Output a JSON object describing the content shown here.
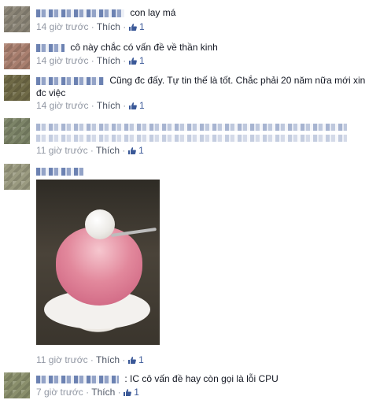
{
  "comments": [
    {
      "text": "con lay má",
      "time": "14 giờ trước",
      "like": "Thích",
      "likes": "1"
    },
    {
      "text": "cô này chắc có vấn đề về thần kinh",
      "time": "14 giờ trước",
      "like": "Thích",
      "likes": "1"
    },
    {
      "text_line1": "Cũng đc đấy. Tự tin thế là tốt. Chắc phải 20 năm nữa mới xin",
      "text_line2": "đc việc",
      "time": "14 giờ trước",
      "like": "Thích",
      "likes": "1"
    },
    {
      "time": "11 giờ trước",
      "like": "Thích",
      "likes": "1"
    },
    {
      "time": "11 giờ trước",
      "like": "Thích",
      "likes": "1"
    },
    {
      "text": ": IC cô vấn đề hay còn gọi là lỗi CPU",
      "time": "7 giờ trước",
      "like": "Thích",
      "likes": "1"
    }
  ],
  "colors": {
    "link": "#3b5998",
    "meta": "#9197a3",
    "text": "#141823"
  },
  "icons": {
    "like": "thumbs-up-icon"
  }
}
